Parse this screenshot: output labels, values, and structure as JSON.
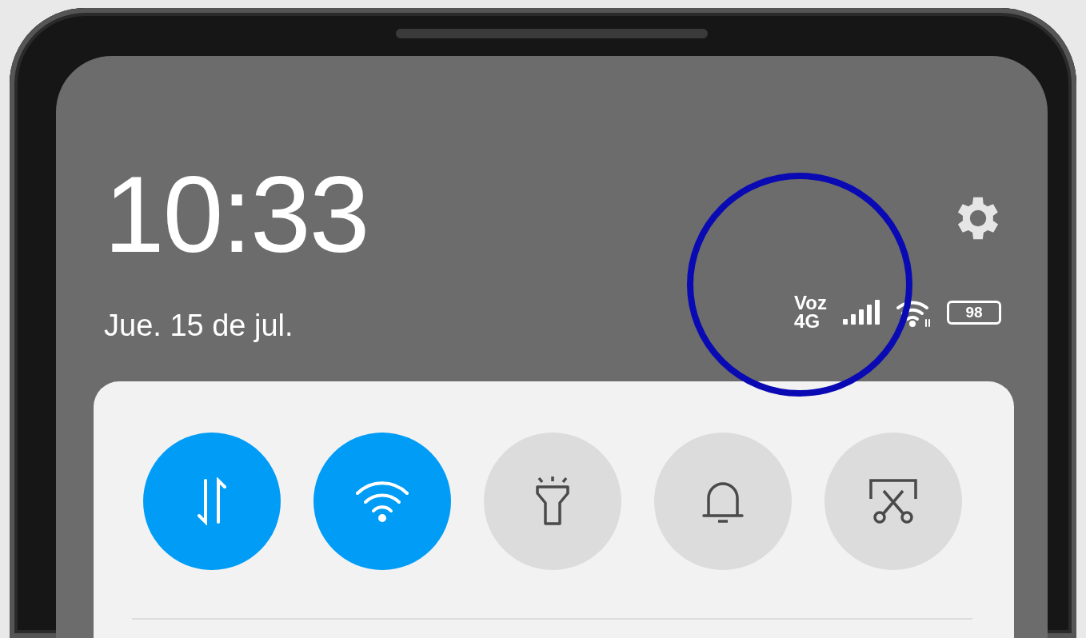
{
  "status": {
    "time": "10:33",
    "date": "Jue. 15 de jul.",
    "network_label": "Voz",
    "network_type": "4G",
    "battery": "98"
  },
  "toggles": [
    {
      "kind": "data",
      "on": true
    },
    {
      "kind": "wifi",
      "on": true
    },
    {
      "kind": "flashlight",
      "on": false
    },
    {
      "kind": "sound",
      "on": false
    },
    {
      "kind": "screenshot",
      "on": false
    }
  ]
}
